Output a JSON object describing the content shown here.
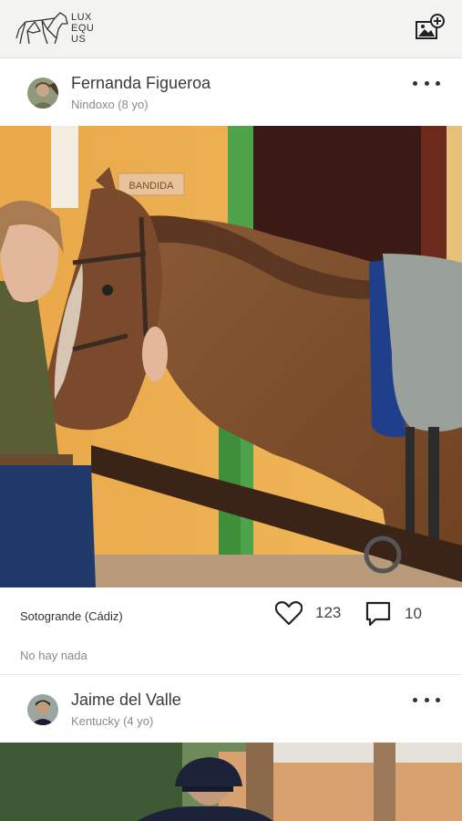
{
  "header": {
    "logo_lines": [
      "LUX",
      "EQU",
      "US"
    ],
    "add_photo_icon": "add-image-icon"
  },
  "posts": [
    {
      "author": "Fernanda Figueroa",
      "horse": "Nindoxo (8 yo)",
      "location": "Sotogrande (Cádiz)",
      "likes": "123",
      "comments": "10",
      "comment_preview": "No hay nada"
    },
    {
      "author": "Jaime del Valle",
      "horse": "Kentucky (4 yo)"
    }
  ],
  "photo_text": {
    "stall_sign": "BANDIDA"
  },
  "colors": {
    "topbar": "#f3f3f1",
    "text": "#333333",
    "muted": "#8a8a8a"
  }
}
